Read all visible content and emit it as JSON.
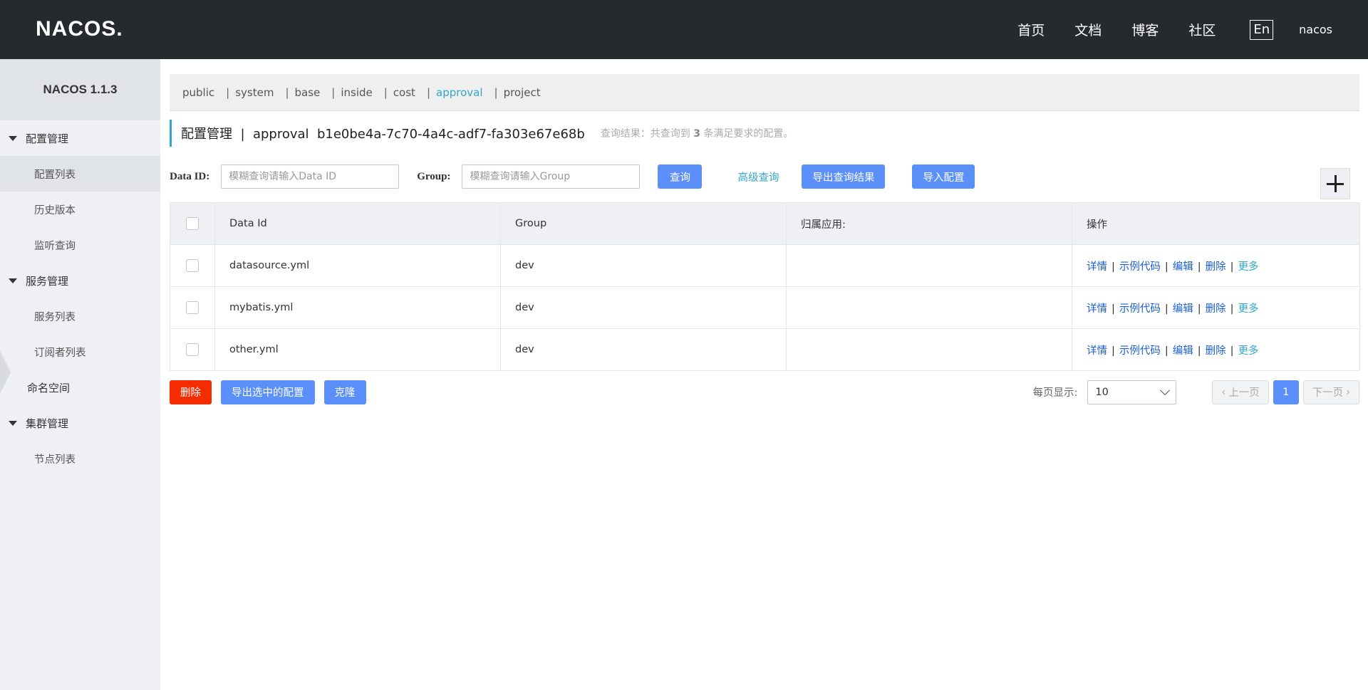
{
  "header": {
    "logo": "NACOS.",
    "nav": [
      "首页",
      "文档",
      "博客",
      "社区"
    ],
    "lang": "En",
    "user": "nacos"
  },
  "sidebar": {
    "version": "NACOS 1.1.3",
    "groups": [
      {
        "label": "配置管理",
        "items": [
          "配置列表",
          "历史版本",
          "监听查询"
        ]
      },
      {
        "label": "服务管理",
        "items": [
          "服务列表",
          "订阅者列表"
        ]
      },
      {
        "label": "命名空间"
      },
      {
        "label": "集群管理",
        "items": [
          "节点列表"
        ]
      }
    ]
  },
  "namespaces": [
    "public",
    "system",
    "base",
    "inside",
    "cost",
    "approval",
    "project"
  ],
  "active_namespace": "approval",
  "title": {
    "text": "配置管理  |  approval  b1e0be4a-7c70-4a4c-adf7-fa303e67e68b",
    "hint_prefix": "查询结果：共查询到",
    "hint_count": "3",
    "hint_suffix": "条满足要求的配置。"
  },
  "search": {
    "dataid_label": "Data ID:",
    "dataid_placeholder": "模糊查询请输入Data ID",
    "group_label": "Group:",
    "group_placeholder": "模糊查询请输入Group",
    "query_btn": "查询",
    "advanced_btn": "高级查询",
    "export_btn": "导出查询结果",
    "import_btn": "导入配置"
  },
  "table": {
    "columns": [
      "Data Id",
      "Group",
      "归属应用:",
      "操作"
    ],
    "rows": [
      {
        "data_id": "datasource.yml",
        "group": "dev",
        "app": ""
      },
      {
        "data_id": "mybatis.yml",
        "group": "dev",
        "app": ""
      },
      {
        "data_id": "other.yml",
        "group": "dev",
        "app": ""
      }
    ],
    "ops": [
      "详情",
      "示例代码",
      "编辑",
      "删除",
      "更多"
    ]
  },
  "footer": {
    "delete_btn": "删除",
    "export_selected_btn": "导出选中的配置",
    "clone_btn": "克隆",
    "page_size_label": "每页显示:",
    "page_size": "10",
    "prev": "上一页",
    "page": "1",
    "next": "下一页"
  },
  "colors": {
    "header_bg": "#252a2f",
    "primary": "#5b8ff9",
    "danger": "#f52c00",
    "accent": "#2fa7c9"
  }
}
